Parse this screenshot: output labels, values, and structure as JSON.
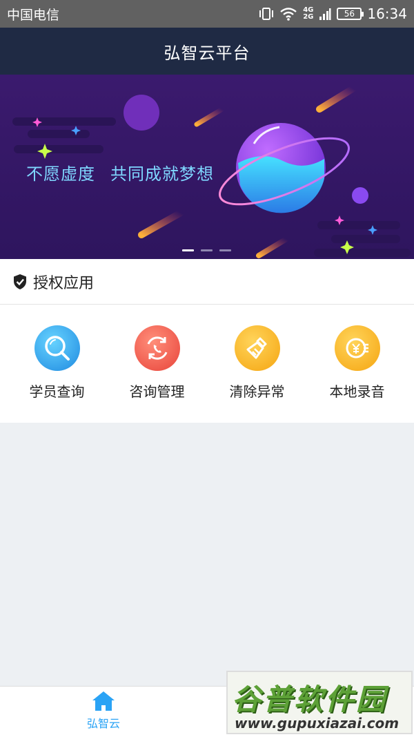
{
  "status_bar": {
    "carrier": "中国电信",
    "network_top": "4G",
    "network_bottom": "2G",
    "battery": "56",
    "time": "16:34",
    "icons": [
      "vibrate-icon",
      "wifi-icon",
      "signal-icon",
      "battery-icon"
    ]
  },
  "nav": {
    "title": "弘智云平台"
  },
  "banner": {
    "slogan_part1": "不愿虚度",
    "slogan_part2": "共同成就梦想",
    "slides": 3,
    "active_slide": 1
  },
  "section": {
    "icon": "shield-check-icon",
    "title": "授权应用",
    "apps": [
      {
        "label": "学员查询",
        "icon": "search-icon",
        "color": "#2ea8ef"
      },
      {
        "label": "咨询管理",
        "icon": "phone-refresh-icon",
        "color": "#f25a48"
      },
      {
        "label": "清除异常",
        "icon": "broom-icon",
        "color": "#f8b322"
      },
      {
        "label": "本地录音",
        "icon": "yen-coin-icon",
        "color": "#f8b322"
      }
    ]
  },
  "tabbar": {
    "tabs": [
      {
        "label": "弘智云",
        "icon": "home-icon",
        "color": "#2aa3f5"
      }
    ]
  },
  "watermark": {
    "line1": "谷普软件园",
    "line2": "www.gupuxiazai.com"
  }
}
